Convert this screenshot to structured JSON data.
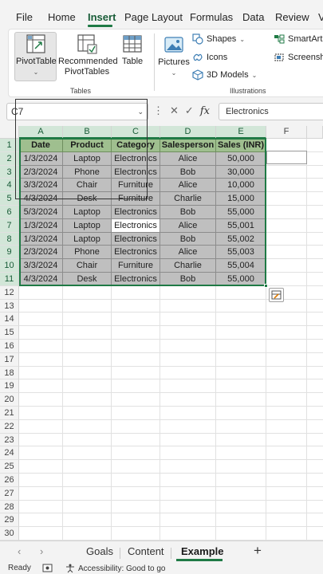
{
  "menu": {
    "tabs": [
      "File",
      "Home",
      "Insert",
      "Page Layout",
      "Formulas",
      "Data",
      "Review",
      "V"
    ],
    "active": "Insert"
  },
  "ribbon": {
    "tables_group": {
      "label": "Tables",
      "pivot_table": "PivotTable",
      "recommended_pivot_line1": "Recommended",
      "recommended_pivot_line2": "PivotTables",
      "table": "Table"
    },
    "illustrations_group": {
      "label": "Illustrations",
      "pictures": "Pictures",
      "shapes": "Shapes",
      "icons": "Icons",
      "models_3d": "3D Models",
      "smartart": "SmartArt",
      "screenshot": "Screensho"
    }
  },
  "formula_bar": {
    "name_box": "C7",
    "formula_value": "Electronics",
    "fx_label": "fx"
  },
  "grid": {
    "columns": [
      "A",
      "B",
      "C",
      "D",
      "E",
      "F"
    ],
    "rows": [
      "1",
      "2",
      "3",
      "4",
      "5",
      "6",
      "7",
      "8",
      "9",
      "10",
      "11",
      "12",
      "13",
      "14",
      "15",
      "16",
      "17",
      "18",
      "19",
      "20",
      "21",
      "22",
      "23",
      "24",
      "25",
      "26",
      "27",
      "28",
      "29",
      "30"
    ],
    "table_headers": [
      "Date",
      "Product",
      "Category",
      "Salesperson",
      "Sales (INR)"
    ],
    "table_rows": [
      [
        "1/3/2024",
        "Laptop",
        "Electronics",
        "Alice",
        "50,000"
      ],
      [
        "2/3/2024",
        "Phone",
        "Electronics",
        "Bob",
        "30,000"
      ],
      [
        "3/3/2024",
        "Chair",
        "Furniture",
        "Alice",
        "10,000"
      ],
      [
        "4/3/2024",
        "Desk",
        "Furniture",
        "Charlie",
        "15,000"
      ],
      [
        "5/3/2024",
        "Laptop",
        "Electronics",
        "Bob",
        "55,000"
      ],
      [
        "1/3/2024",
        "Laptop",
        "Electronics",
        "Alice",
        "55,001"
      ],
      [
        "1/3/2024",
        "Laptop",
        "Electronics",
        "Bob",
        "55,002"
      ],
      [
        "2/3/2024",
        "Phone",
        "Electronics",
        "Alice",
        "55,003"
      ],
      [
        "3/3/2024",
        "Chair",
        "Furniture",
        "Charlie",
        "55,004"
      ],
      [
        "4/3/2024",
        "Desk",
        "Electronics",
        "Bob",
        "55,000"
      ]
    ]
  },
  "sheets": {
    "tabs": [
      "Goals",
      "Content",
      "Example"
    ],
    "active": "Example"
  },
  "status": {
    "ready": "Ready",
    "accessibility": "Accessibility: Good to go"
  },
  "colors": {
    "accent": "#1f7a45",
    "header_fill": "#9fbf8f",
    "table_fill": "#bfbfbf"
  }
}
